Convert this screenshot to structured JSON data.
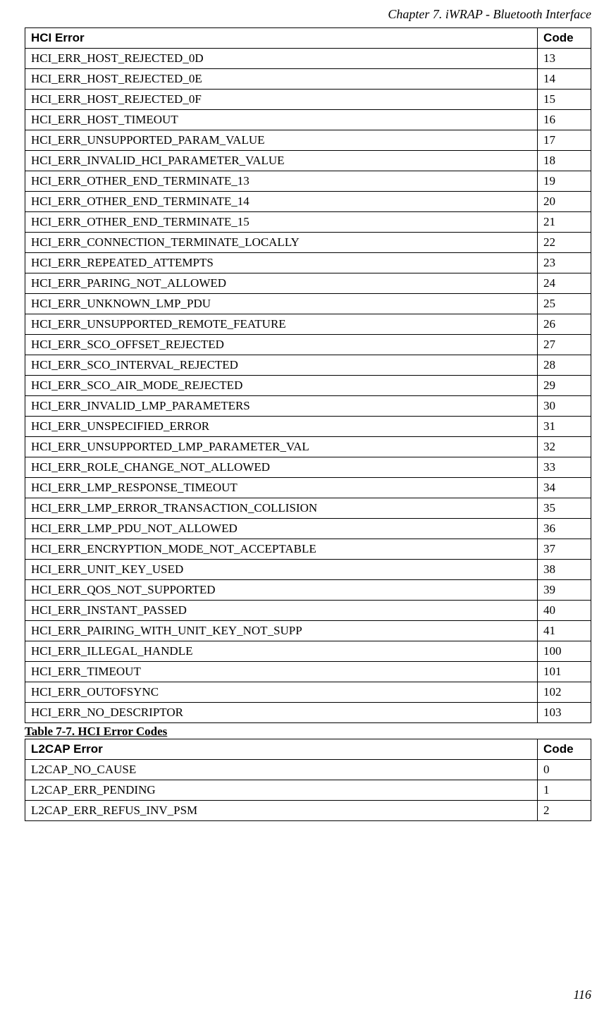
{
  "chapter_header": "Chapter 7. iWRAP - Bluetooth Interface",
  "page_number": "116",
  "table1": {
    "header_error": "HCI Error",
    "header_code": "Code",
    "rows": [
      {
        "error": "HCI_ERR_HOST_REJECTED_0D",
        "code": "13"
      },
      {
        "error": "HCI_ERR_HOST_REJECTED_0E",
        "code": "14"
      },
      {
        "error": "HCI_ERR_HOST_REJECTED_0F",
        "code": "15"
      },
      {
        "error": "HCI_ERR_HOST_TIMEOUT",
        "code": "16"
      },
      {
        "error": "HCI_ERR_UNSUPPORTED_PARAM_VALUE",
        "code": "17"
      },
      {
        "error": "HCI_ERR_INVALID_HCI_PARAMETER_VALUE",
        "code": "18"
      },
      {
        "error": "HCI_ERR_OTHER_END_TERMINATE_13",
        "code": "19"
      },
      {
        "error": "HCI_ERR_OTHER_END_TERMINATE_14",
        "code": "20"
      },
      {
        "error": "HCI_ERR_OTHER_END_TERMINATE_15",
        "code": "21"
      },
      {
        "error": "HCI_ERR_CONNECTION_TERMINATE_LOCALLY",
        "code": "22"
      },
      {
        "error": "HCI_ERR_REPEATED_ATTEMPTS",
        "code": "23"
      },
      {
        "error": "HCI_ERR_PARING_NOT_ALLOWED",
        "code": "24"
      },
      {
        "error": "HCI_ERR_UNKNOWN_LMP_PDU",
        "code": "25"
      },
      {
        "error": "HCI_ERR_UNSUPPORTED_REMOTE_FEATURE",
        "code": "26"
      },
      {
        "error": "HCI_ERR_SCO_OFFSET_REJECTED",
        "code": "27"
      },
      {
        "error": "HCI_ERR_SCO_INTERVAL_REJECTED",
        "code": "28"
      },
      {
        "error": "HCI_ERR_SCO_AIR_MODE_REJECTED",
        "code": "29"
      },
      {
        "error": "HCI_ERR_INVALID_LMP_PARAMETERS",
        "code": "30"
      },
      {
        "error": "HCI_ERR_UNSPECIFIED_ERROR",
        "code": "31"
      },
      {
        "error": "HCI_ERR_UNSUPPORTED_LMP_PARAMETER_VAL",
        "code": "32"
      },
      {
        "error": "HCI_ERR_ROLE_CHANGE_NOT_ALLOWED",
        "code": "33"
      },
      {
        "error": "HCI_ERR_LMP_RESPONSE_TIMEOUT",
        "code": "34"
      },
      {
        "error": "HCI_ERR_LMP_ERROR_TRANSACTION_COLLISION",
        "code": "35"
      },
      {
        "error": "HCI_ERR_LMP_PDU_NOT_ALLOWED",
        "code": "36"
      },
      {
        "error": "HCI_ERR_ENCRYPTION_MODE_NOT_ACCEPTABLE",
        "code": "37"
      },
      {
        "error": "HCI_ERR_UNIT_KEY_USED",
        "code": "38"
      },
      {
        "error": "HCI_ERR_QOS_NOT_SUPPORTED",
        "code": "39"
      },
      {
        "error": "HCI_ERR_INSTANT_PASSED",
        "code": "40"
      },
      {
        "error": "HCI_ERR_PAIRING_WITH_UNIT_KEY_NOT_SUPP",
        "code": "41"
      },
      {
        "error": "HCI_ERR_ILLEGAL_HANDLE",
        "code": "100"
      },
      {
        "error": "HCI_ERR_TIMEOUT",
        "code": "101"
      },
      {
        "error": "HCI_ERR_OUTOFSYNC",
        "code": "102"
      },
      {
        "error": "HCI_ERR_NO_DESCRIPTOR",
        "code": "103"
      }
    ]
  },
  "table1_caption": "Table 7-7. HCI Error Codes",
  "table2": {
    "header_error": "L2CAP Error",
    "header_code": "Code",
    "rows": [
      {
        "error": "L2CAP_NO_CAUSE",
        "code": "0"
      },
      {
        "error": "L2CAP_ERR_PENDING",
        "code": "1"
      },
      {
        "error": "L2CAP_ERR_REFUS_INV_PSM",
        "code": "2"
      }
    ]
  }
}
